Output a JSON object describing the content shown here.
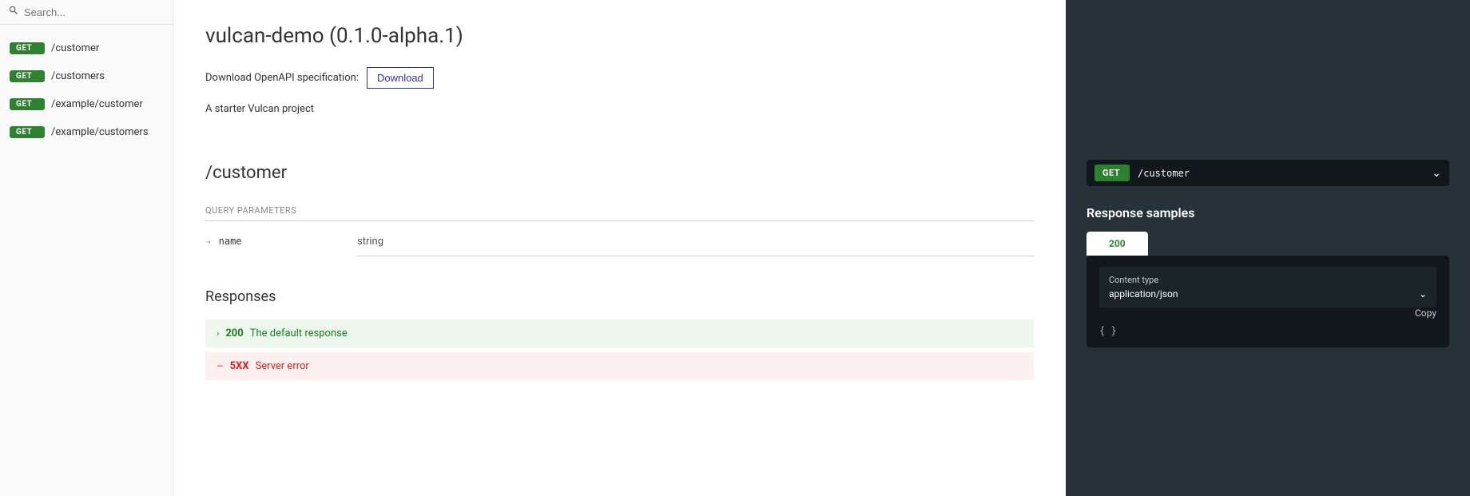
{
  "search": {
    "placeholder": "Search..."
  },
  "sidebar": {
    "items": [
      {
        "method": "GET",
        "path": "/customer"
      },
      {
        "method": "GET",
        "path": "/customers"
      },
      {
        "method": "GET",
        "path": "/example/customer"
      },
      {
        "method": "GET",
        "path": "/example/customers"
      }
    ]
  },
  "header": {
    "title": "vulcan-demo (0.1.0-alpha.1)",
    "spec_label": "Download OpenAPI specification:",
    "download_btn": "Download",
    "description": "A starter Vulcan project"
  },
  "endpoint": {
    "title": "/customer",
    "query_params_label": "QUERY PARAMETERS",
    "params": [
      {
        "name": "name",
        "type": "string"
      }
    ],
    "responses_heading": "Responses",
    "responses": [
      {
        "code": "200",
        "desc": "The default response",
        "kind": "success"
      },
      {
        "code": "5XX",
        "desc": "Server error",
        "kind": "error"
      }
    ]
  },
  "right": {
    "method": "GET",
    "path": "/customer",
    "samples_heading": "Response samples",
    "active_tab": "200",
    "content_type_label": "Content type",
    "content_type_value": "application/json",
    "copy_label": "Copy",
    "json_body": "{ }"
  }
}
